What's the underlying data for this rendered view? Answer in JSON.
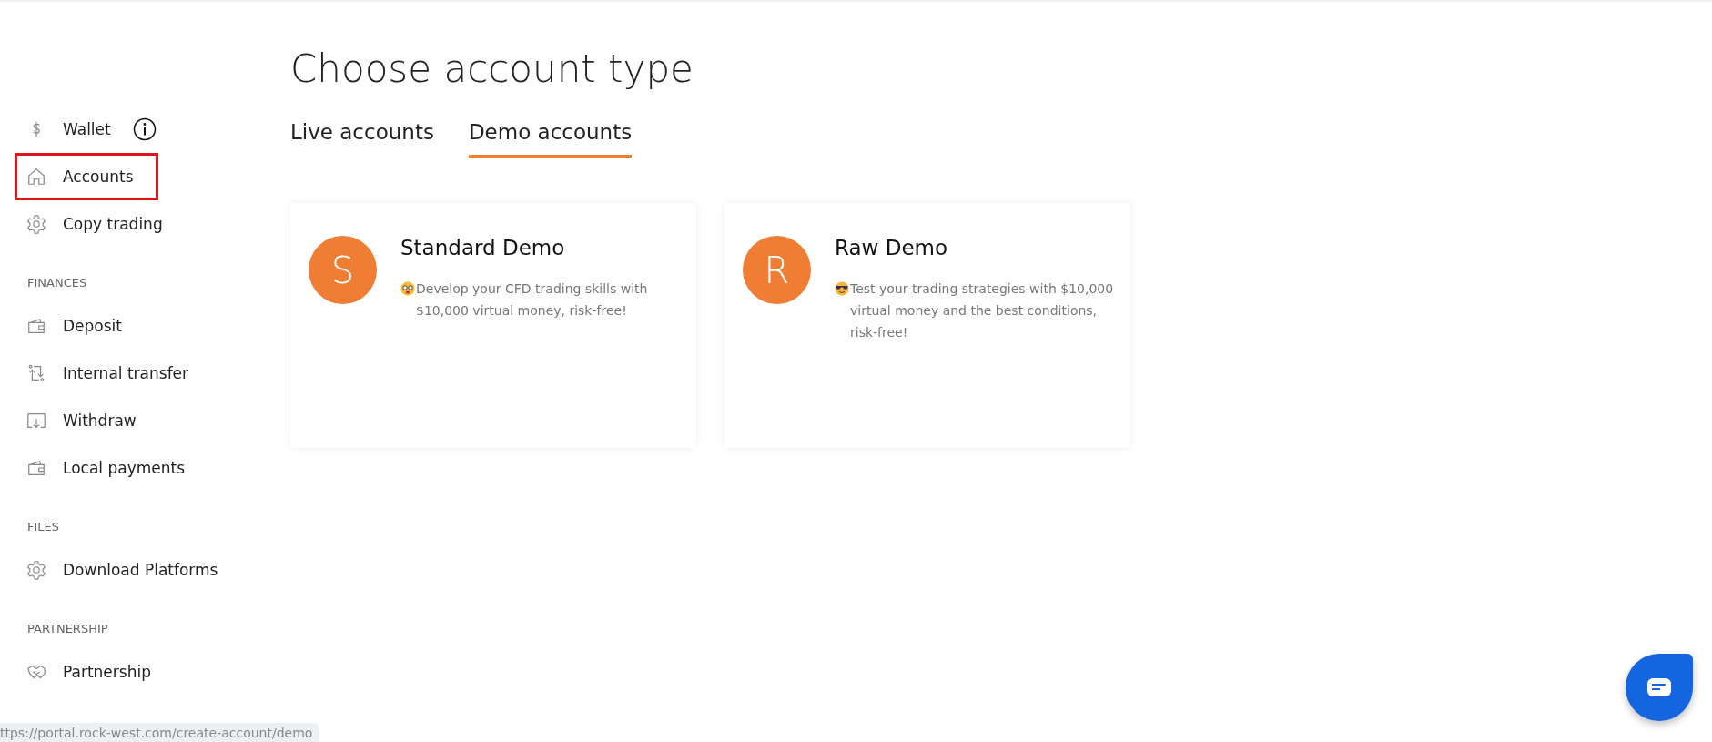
{
  "sidebar": {
    "sections": [
      {
        "items": [
          {
            "label": "Wallet",
            "kind": "dollar",
            "info": true,
            "highlighted": false
          },
          {
            "label": "Accounts",
            "kind": "house",
            "info": false,
            "highlighted": true
          },
          {
            "label": "Copy trading",
            "kind": "gear",
            "info": false,
            "highlighted": false
          }
        ]
      },
      {
        "heading": "FINANCES",
        "items": [
          {
            "label": "Deposit",
            "kind": "wallet",
            "info": false,
            "highlighted": false
          },
          {
            "label": "Internal transfer",
            "kind": "transfer",
            "info": false,
            "highlighted": false
          },
          {
            "label": "Withdraw",
            "kind": "withdraw",
            "info": false,
            "highlighted": false
          },
          {
            "label": "Local payments",
            "kind": "wallet",
            "info": false,
            "highlighted": false
          }
        ]
      },
      {
        "heading": "FILES",
        "items": [
          {
            "label": "Download Platforms",
            "kind": "gear",
            "info": false,
            "highlighted": false
          }
        ]
      },
      {
        "heading": "PARTNERSHIP",
        "items": [
          {
            "label": "Partnership",
            "kind": "handshake",
            "info": false,
            "highlighted": false
          }
        ]
      }
    ]
  },
  "page_title": "Choose account type",
  "tabs": [
    {
      "label": "Live accounts",
      "selected": false
    },
    {
      "label": "Demo accounts",
      "selected": true
    }
  ],
  "cards": [
    {
      "initial": "S",
      "title": "Standard Demo",
      "kind": "nerd",
      "description": "Develop your CFD trading skills with $10,000 virtual money, risk-free!"
    },
    {
      "initial": "R",
      "title": "Raw Demo",
      "kind": "sunglasses",
      "description": "Test your trading strategies with $10,000 virtual money and the best conditions, risk-free!"
    }
  ],
  "status_bar": {
    "url": "ttps://portal.rock-west.com/create-account/demo"
  }
}
